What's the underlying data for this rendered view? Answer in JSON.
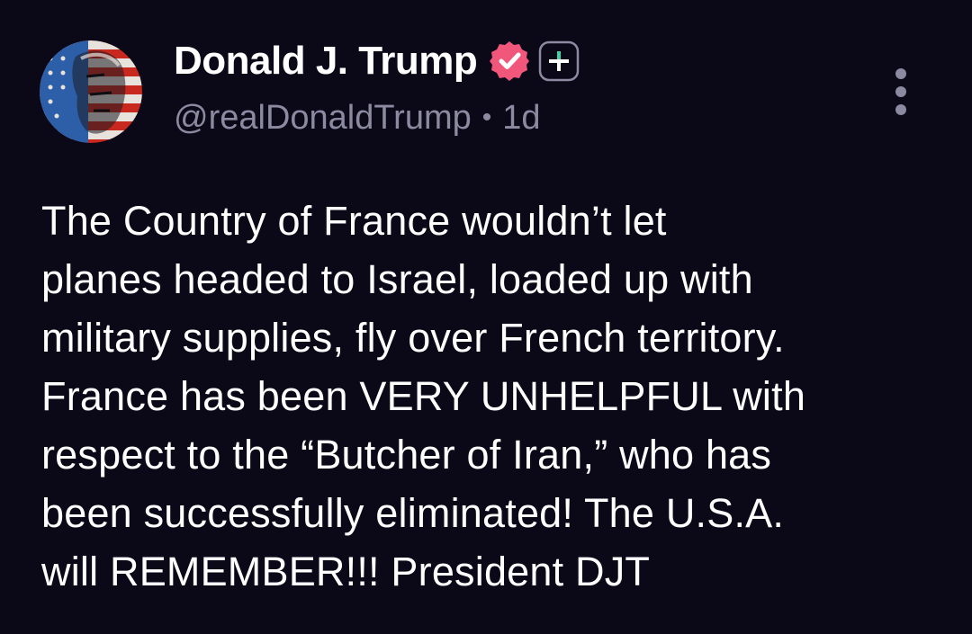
{
  "post": {
    "author": {
      "display_name": "Donald J. Trump",
      "handle": "@realDonaldTrump",
      "avatar": "avatar-flag-portrait",
      "verified_icon": "verified-badge-icon",
      "plus_icon": "plus-icon"
    },
    "separator": "•",
    "timestamp": "1d",
    "more_icon": "more-vertical-icon",
    "text": "The Country of France wouldn’t let\nplanes headed to Israel, loaded up with\nmilitary supplies, fly over French territory.\nFrance has been VERY UNHELPFUL with\nrespect to the “Butcher of Iran,” who has\nbeen successfully eliminated! The U.S.A.\nwill REMEMBER!!! President DJT"
  },
  "colors": {
    "background": "#0b0818",
    "text": "#ffffff",
    "muted": "#8c8aa0",
    "verified": "#f0577a"
  }
}
